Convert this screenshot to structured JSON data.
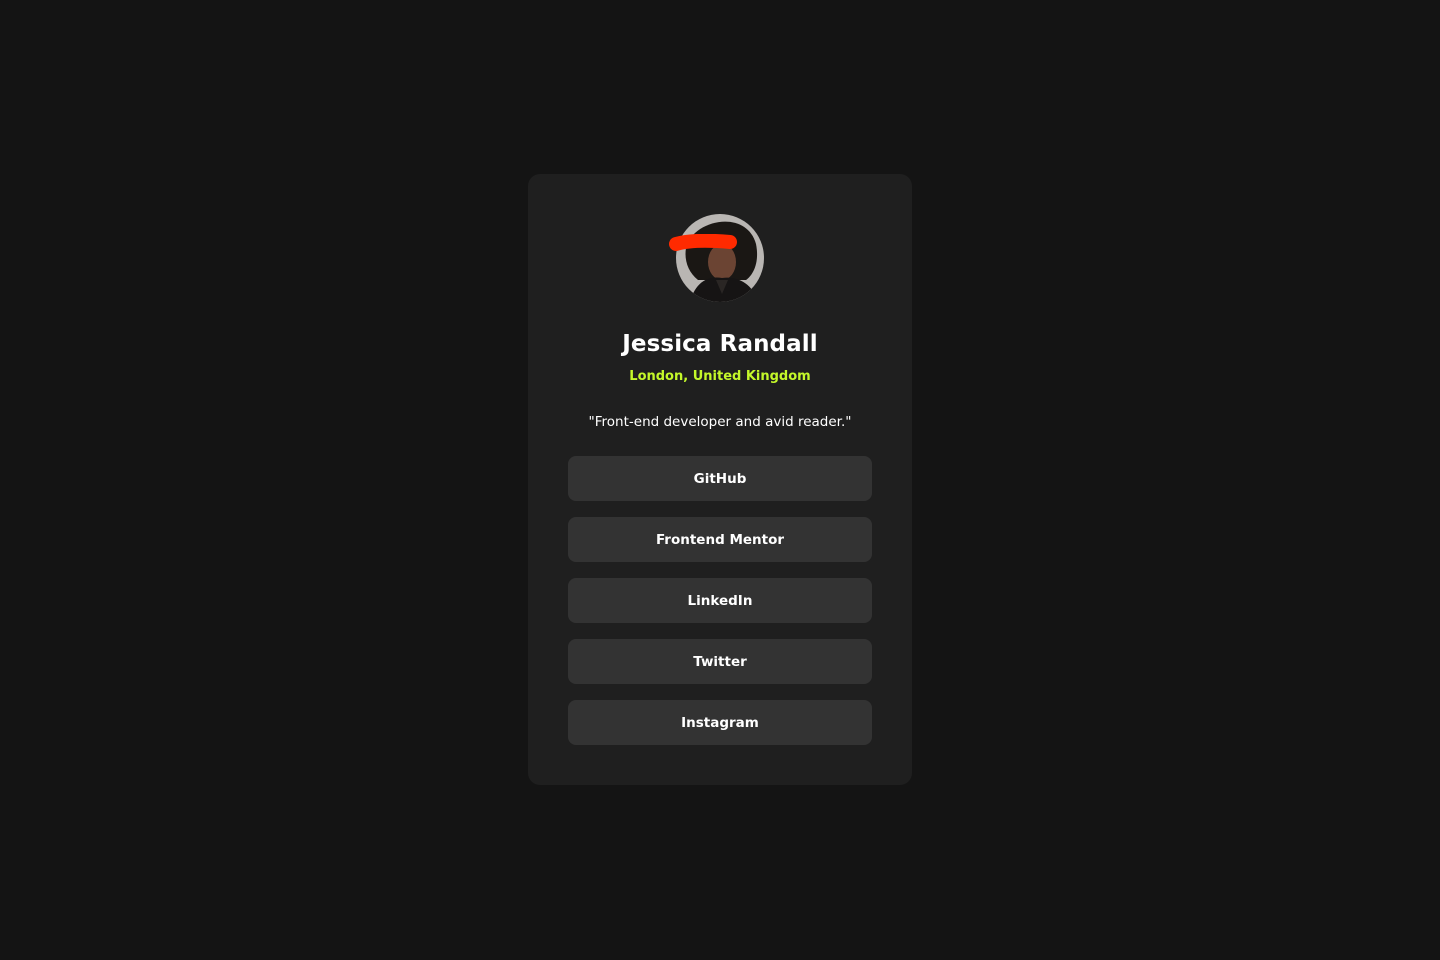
{
  "profile": {
    "avatar_icon": "profile-photo",
    "name": "Jessica Randall",
    "location": "London, United Kingdom",
    "bio": "\"Front-end developer and avid reader.\""
  },
  "links": [
    {
      "label": "GitHub"
    },
    {
      "label": "Frontend Mentor"
    },
    {
      "label": "LinkedIn"
    },
    {
      "label": "Twitter"
    },
    {
      "label": "Instagram"
    }
  ],
  "colors": {
    "background": "#141414",
    "card": "#1f1f1f",
    "button": "#333333",
    "accent": "#c4f82a",
    "redaction": "#ff2a00"
  }
}
